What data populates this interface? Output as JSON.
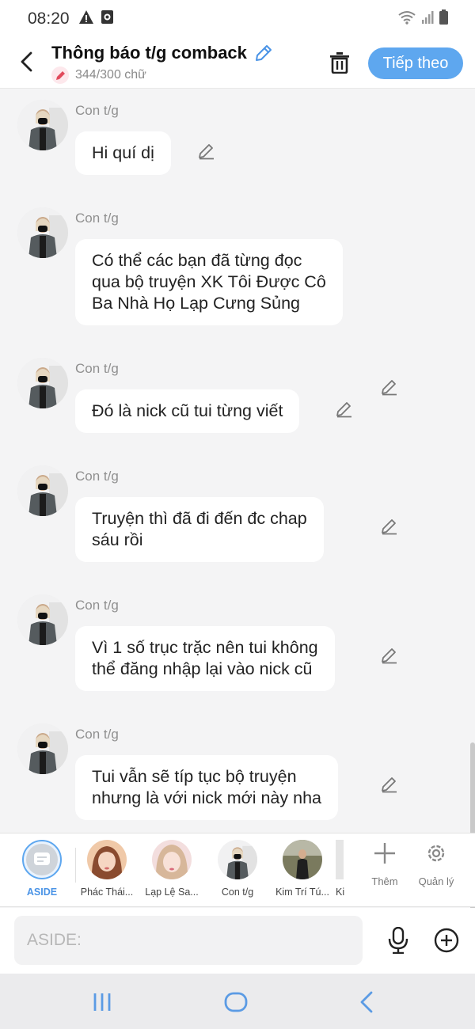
{
  "status": {
    "time": "08:20"
  },
  "header": {
    "title": "Thông báo t/g comback",
    "word_count": "344/300 chữ",
    "next_label": "Tiếp theo"
  },
  "messages": [
    {
      "sender": "Con t/g",
      "text": "Hi quí dị"
    },
    {
      "sender": "Con t/g",
      "text": "Có thể các bạn đã từng đọc\nqua bộ truyện XK Tôi Được Cô\nBa Nhà Họ Lạp Cưng Sủng"
    },
    {
      "sender": "Con t/g",
      "text": "Đó là nick cũ tui từng viết"
    },
    {
      "sender": "Con t/g",
      "text": "Truyện thì đã đi đến đc chap\nsáu rồi"
    },
    {
      "sender": "Con t/g",
      "text": "Vì 1 số trục trặc nên tui không\nthể đăng nhập lại vào nick cũ"
    },
    {
      "sender": "Con t/g",
      "text": "Tui vẫn sẽ típ tục bộ truyện\nnhưng là với nick mới này nha"
    }
  ],
  "characters": [
    {
      "label": "ASIDE"
    },
    {
      "label": "Phác Thái..."
    },
    {
      "label": "Lạp Lệ Sa..."
    },
    {
      "label": "Con t/g"
    },
    {
      "label": "Kim Trí Tú..."
    },
    {
      "label": "Ki"
    }
  ],
  "tools": {
    "add_label": "Thêm",
    "manage_label": "Quản lý"
  },
  "composer": {
    "placeholder": "ASIDE:"
  },
  "colors": {
    "accent": "#5ea7ef",
    "bubble": "#ffffff",
    "background": "#f4f4f5"
  }
}
